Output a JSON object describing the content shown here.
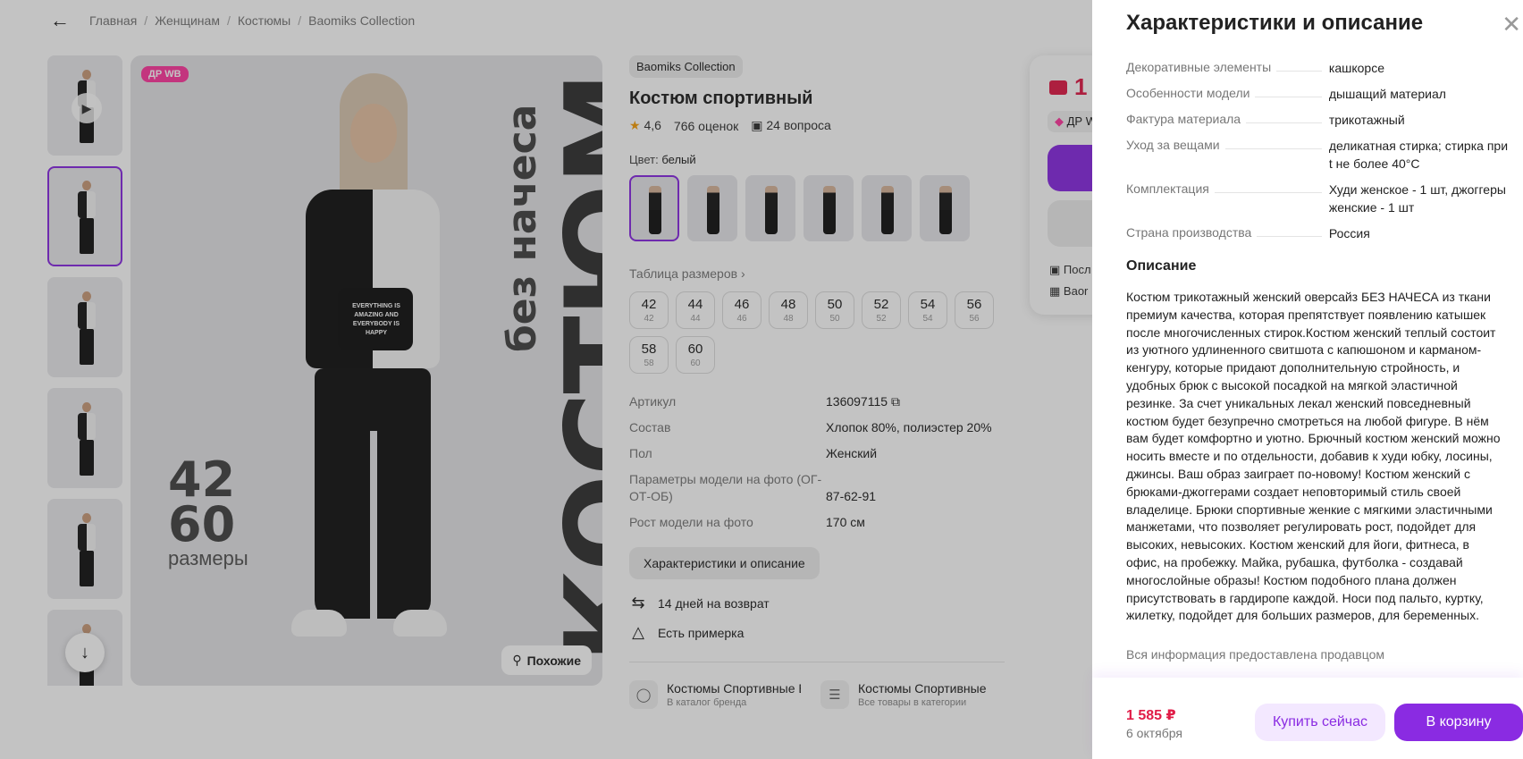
{
  "breadcrumb": {
    "items": [
      "Главная",
      "Женщинам",
      "Костюмы",
      "Baomiks Collection"
    ]
  },
  "gallery": {
    "badge": "ДР WB",
    "banner_main": "КОСТЮМ",
    "banner_sub": "без начеса",
    "sizes_range": [
      "42",
      "60"
    ],
    "sizes_word": "размеры",
    "print_text": "EVERYTHING IS AMAZING AND EVERYBODY IS HAPPY",
    "similar_label": "Похожие"
  },
  "product": {
    "brand": "Baomiks Collection",
    "title": "Костюм спортивный",
    "rating": "4,6",
    "reviews": "766 оценок",
    "questions": "24 вопроса",
    "color_label": "Цвет:",
    "color_value": "белый",
    "size_table_link": "Таблица размеров",
    "sizes": [
      {
        "size": "42",
        "ru": "42"
      },
      {
        "size": "44",
        "ru": "44"
      },
      {
        "size": "46",
        "ru": "46"
      },
      {
        "size": "48",
        "ru": "48"
      },
      {
        "size": "50",
        "ru": "50"
      },
      {
        "size": "52",
        "ru": "52"
      },
      {
        "size": "54",
        "ru": "54"
      },
      {
        "size": "56",
        "ru": "56"
      },
      {
        "size": "58",
        "ru": "58"
      },
      {
        "size": "60",
        "ru": "60"
      }
    ],
    "params": [
      {
        "k": "Артикул",
        "v": "136097115"
      },
      {
        "k": "Состав",
        "v": "Хлопок 80%, полиэстер 20%"
      },
      {
        "k": "Пол",
        "v": "Женский"
      },
      {
        "k": "Параметры модели на фото (ОГ-ОТ-ОБ)",
        "v": "87-62-91"
      },
      {
        "k": "Рост модели на фото",
        "v": "170 см"
      }
    ],
    "characteristics_button": "Характеристики и описание",
    "returns": "14 дней на возврат",
    "fitting": "Есть примерка",
    "categories": [
      {
        "title": "Костюмы Спортивные Baomiks Collection",
        "subtitle": "В каталог бренда"
      },
      {
        "title": "Костюмы Спортивные",
        "subtitle": "Все товары в категории"
      }
    ]
  },
  "buybox": {
    "price_partial": "1",
    "chip_partial": "ДР W",
    "line1": "Посл",
    "line2": "Baor"
  },
  "panel": {
    "title": "Характеристики и описание",
    "specs": [
      {
        "k": "Декоративные элементы",
        "v": "кашкорсе"
      },
      {
        "k": "Особенности модели",
        "v": "дышащий материал"
      },
      {
        "k": "Фактура материала",
        "v": "трикотажный"
      },
      {
        "k": "Уход за вещами",
        "v": "деликатная стирка; стирка при t не более 40°С"
      },
      {
        "k": "Комплектация",
        "v": "Худи женское - 1 шт, джоггеры женские - 1 шт"
      },
      {
        "k": "Страна производства",
        "v": "Россия"
      }
    ],
    "description_heading": "Описание",
    "description": "Костюм трикотажный женский оверсайз БЕЗ НАЧЕСА из ткани премиум качества, которая препятствует появлению катышек после многочисленных стирок.Костюм женский теплый состоит из уютного удлиненного свитшота с капюшоном и карманом-кенгуру, которые придают дополнительную стройность, и удобных брюк с высокой посадкой на мягкой эластичной резинке. За счет уникальных лекал женский повседневный костюм будет безупречно смотреться на любой фигуре. В нём вам будет комфортно и уютно. Брючный костюм женский можно носить вместе и по отдельности, добавив к худи юбку, лосины, джинсы. Ваш образ заиграет по-новому! Костюм женский с брюками-джоггерами создает неповторимый стиль своей владелице. Брюки спортивные женкие с мягкими эластичными манжетами, что позволяет регулировать рост, подойдет для высоких, невысоких. Костюм женский для йоги, фитнеса, в офис, на пробежку. Майка, рубашка, футболка - создавай многослойные образы! Костюм подобного плана должен присутствовать в гардиропе каждой. Носи под пальто, куртку, жилетку, подойдет для больших размеров, для беременных.",
    "seller_note": "Вся информация предоставлена продавцом",
    "footer": {
      "price": "1 585 ₽",
      "date": "6 октября",
      "buy_now": "Купить сейчас",
      "add_to_cart": "В корзину"
    }
  },
  "colors": {
    "accent": "#8a2be2",
    "price": "#e11d48",
    "badge": "#ff3ba0"
  }
}
